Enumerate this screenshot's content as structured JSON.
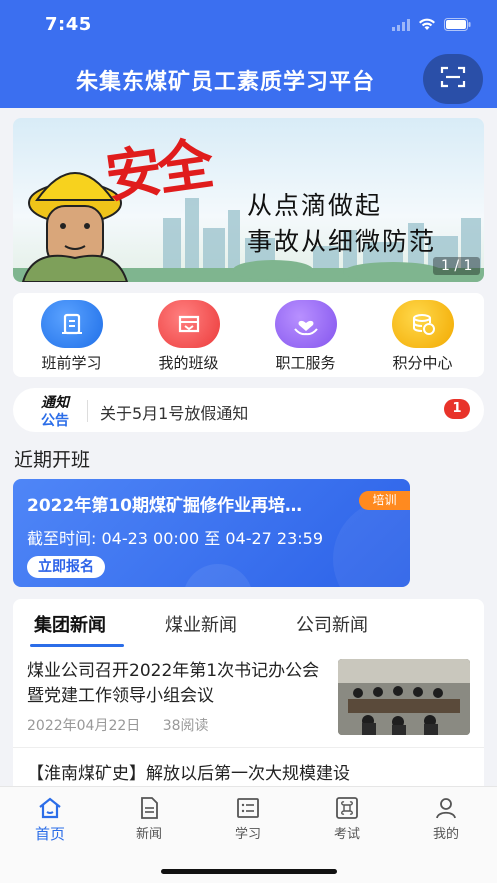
{
  "status_bar": {
    "time": "7:45"
  },
  "header": {
    "title": "朱集东煤矿员工素质学习平台",
    "scan_icon": "scan-icon",
    "color": "#3b6ff0"
  },
  "banner": {
    "big_text": "安全",
    "line1": "从点滴做起",
    "line2": "事故从细微防范",
    "page_indicator": "1 / 1"
  },
  "quick_menu": [
    {
      "label": "班前学习",
      "icon": "study-icon",
      "color": "#2f7df4"
    },
    {
      "label": "我的班级",
      "icon": "class-icon",
      "color": "#f04a4a"
    },
    {
      "label": "职工服务",
      "icon": "service-icon",
      "color": "#8b5cf0"
    },
    {
      "label": "积分中心",
      "icon": "points-icon",
      "color": "#f5b400"
    }
  ],
  "notice": {
    "badge_top": "通知",
    "badge_bottom": "公告",
    "text": "关于5月1号放假通知",
    "count": "1"
  },
  "recent_classes": {
    "section_title": "近期开班",
    "card": {
      "title": "2022年第10期煤矿掘修作业再培…",
      "tag": "培训",
      "time": "截至时间: 04-23 00:00 至 04-27 23:59",
      "enroll_label": "立即报名"
    }
  },
  "news": {
    "tabs": [
      "集团新闻",
      "煤业新闻",
      "公司新闻"
    ],
    "active_tab": 0,
    "items": [
      {
        "title": "煤业公司召开2022年第1次书记办公会暨党建工作领导小组会议",
        "date": "2022年04月22日",
        "reads": "38阅读"
      },
      {
        "title": "【淮南煤矿史】解放以后第一次大规模建设"
      }
    ]
  },
  "tabbar": [
    {
      "label": "首页",
      "icon": "home-icon"
    },
    {
      "label": "新闻",
      "icon": "news-icon"
    },
    {
      "label": "学习",
      "icon": "study-list-icon"
    },
    {
      "label": "考试",
      "icon": "exam-icon"
    },
    {
      "label": "我的",
      "icon": "profile-icon"
    }
  ],
  "tabbar_active": 0,
  "accent_color": "#2b6de8"
}
